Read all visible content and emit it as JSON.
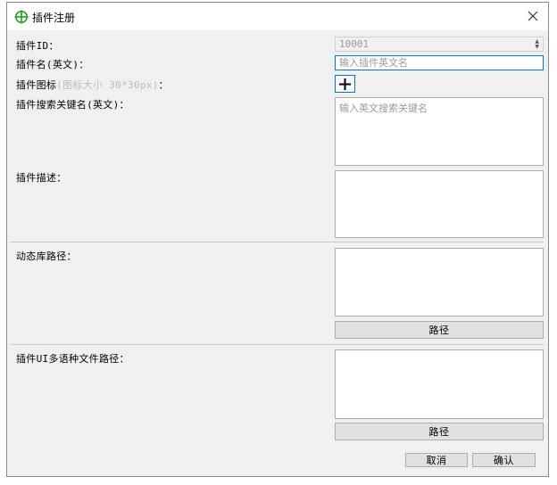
{
  "window": {
    "title": "插件注册"
  },
  "form": {
    "plugin_id": {
      "label": "插件ID：",
      "value": "10001"
    },
    "plugin_name": {
      "label": "插件名(英文)：",
      "placeholder": "输入插件英文名"
    },
    "plugin_icon": {
      "label": "插件图标",
      "hint": "(图标大小 30*30px)",
      "suffix": "："
    },
    "search_keyword": {
      "label": "插件搜索关键名(英文)：",
      "placeholder": "输入英文搜索关键名"
    },
    "description": {
      "label": "插件描述："
    },
    "library_path": {
      "label": "动态库路径：",
      "button": "路径"
    },
    "ui_lang_path": {
      "label": "插件UI多语种文件路径：",
      "button": "路径"
    }
  },
  "footer": {
    "cancel": "取消",
    "confirm": "确认"
  },
  "colors": {
    "accent": "#0078d7",
    "icon_green": "#1fa01f"
  }
}
